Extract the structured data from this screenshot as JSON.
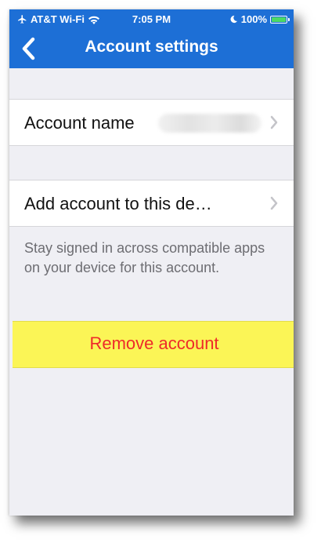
{
  "status_bar": {
    "carrier": "AT&T Wi-Fi",
    "time": "7:05 PM",
    "battery": "100%",
    "battery_level": 1.0
  },
  "nav": {
    "title": "Account settings",
    "back_icon": "chevron-left-icon"
  },
  "rows": {
    "account_name_label": "Account name",
    "add_account_label": "Add account to this de…"
  },
  "note": "Stay signed in across compatible apps on your device for this account.",
  "remove_label": "Remove account",
  "colors": {
    "nav_bar": "#1d6fd6",
    "highlight": "#fbf556",
    "destructive": "#ee2a2a"
  }
}
